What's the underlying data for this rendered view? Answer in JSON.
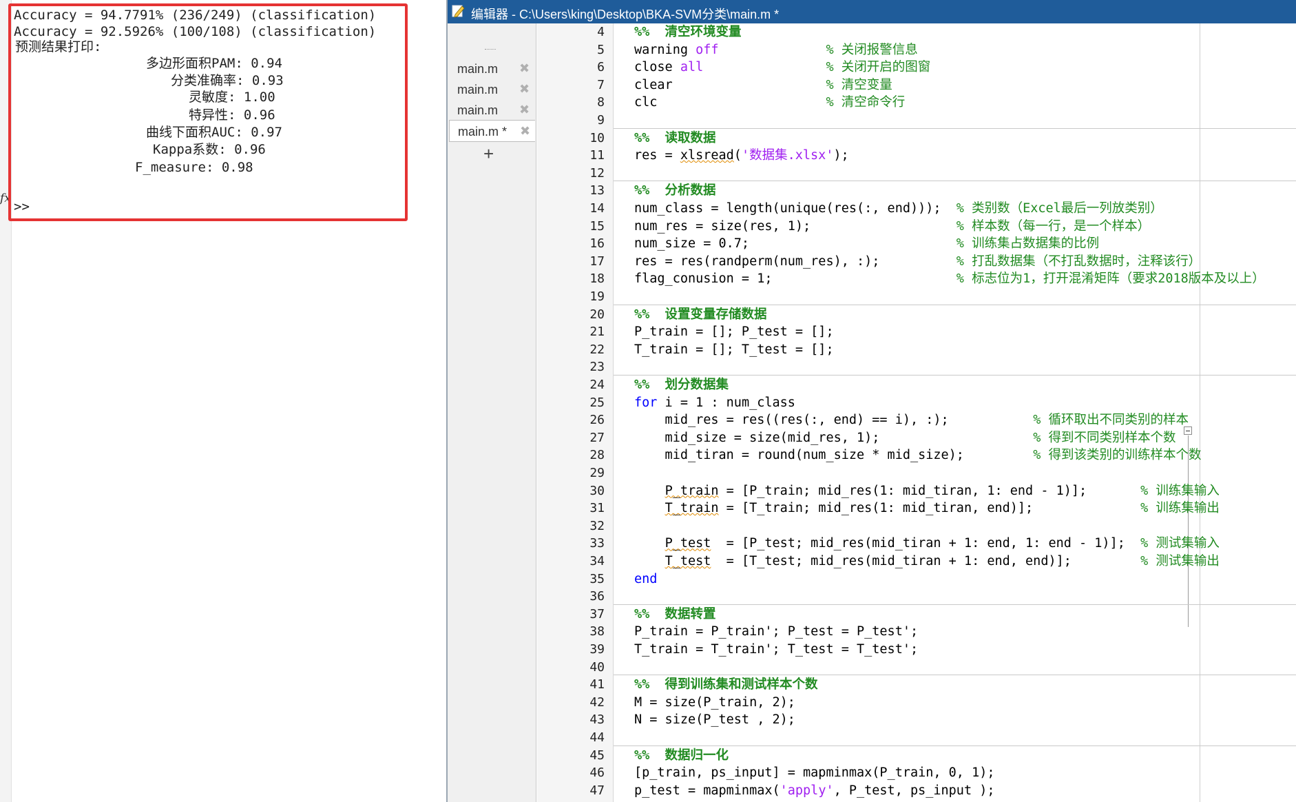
{
  "command_window": {
    "lines": [
      "Accuracy = 94.7791% (236/249) (classification)",
      "Accuracy = 92.5926% (100/108) (classification)",
      "预测结果打印:",
      "多边形面积PAM: 0.94",
      "分类准确率: 0.93",
      "灵敏度: 1.00",
      "特异性: 0.96",
      "曲线下面积AUC: 0.97",
      "Kappa系数: 0.96",
      "F_measure: 0.98"
    ],
    "prompt": ">>",
    "fx_glyph": "fx",
    "highlight_color": "#e53333"
  },
  "editor": {
    "title": "编辑器 - C:\\Users\\king\\Desktop\\BKA-SVM分类\\main.m *",
    "tabs": [
      {
        "label": "main.m",
        "close": "✖"
      },
      {
        "label": "main.m",
        "close": "✖"
      },
      {
        "label": "main.m",
        "close": "✖"
      },
      {
        "label": "main.m *",
        "close": "✖",
        "active": true
      }
    ],
    "add_tab": "+",
    "line_numbers": [
      4,
      5,
      6,
      7,
      8,
      9,
      10,
      11,
      12,
      13,
      14,
      15,
      16,
      17,
      18,
      19,
      20,
      21,
      22,
      23,
      24,
      25,
      26,
      27,
      28,
      29,
      30,
      31,
      32,
      33,
      34,
      35,
      36,
      37,
      38,
      39,
      40,
      41,
      42,
      43,
      44,
      45,
      46,
      47
    ],
    "lines": [
      [
        [
          "cm",
          "%%  清空环境变量"
        ]
      ],
      [
        [
          "n",
          "warning "
        ],
        [
          "str",
          "off"
        ],
        [
          "n",
          "              "
        ],
        [
          "cmt",
          "% 关闭报警信息"
        ]
      ],
      [
        [
          "n",
          "close "
        ],
        [
          "str",
          "all"
        ],
        [
          "n",
          "                "
        ],
        [
          "cmt",
          "% 关闭开启的图窗"
        ]
      ],
      [
        [
          "n",
          "clear                    "
        ],
        [
          "cmt",
          "% 清空变量"
        ]
      ],
      [
        [
          "n",
          "clc                      "
        ],
        [
          "cmt",
          "% 清空命令行"
        ]
      ],
      [],
      [
        [
          "cm",
          "%%  读取数据"
        ]
      ],
      [
        [
          "n",
          "res = "
        ],
        [
          "ul",
          "xlsread"
        ],
        [
          "n",
          "("
        ],
        [
          "str",
          "'数据集.xlsx'"
        ],
        [
          "n",
          ");"
        ]
      ],
      [],
      [
        [
          "cm",
          "%%  分析数据"
        ]
      ],
      [
        [
          "n",
          "num_class = length(unique(res(:, end)));  "
        ],
        [
          "cmt",
          "% 类别数（Excel最后一列放类别）"
        ]
      ],
      [
        [
          "n",
          "num_res = size(res, 1);                   "
        ],
        [
          "cmt",
          "% 样本数（每一行，是一个样本）"
        ]
      ],
      [
        [
          "n",
          "num_size = 0.7;                           "
        ],
        [
          "cmt",
          "% 训练集占数据集的比例"
        ]
      ],
      [
        [
          "n",
          "res = res(randperm(num_res), :);          "
        ],
        [
          "cmt",
          "% 打乱数据集（不打乱数据时，注释该行）"
        ]
      ],
      [
        [
          "n",
          "flag_conusion = 1;                        "
        ],
        [
          "cmt",
          "% 标志位为1，打开混淆矩阵（要求2018版本及以上）"
        ]
      ],
      [],
      [
        [
          "cm",
          "%%  设置变量存储数据"
        ]
      ],
      [
        [
          "n",
          "P_train = []; P_test = [];"
        ]
      ],
      [
        [
          "n",
          "T_train = []; T_test = [];"
        ]
      ],
      [],
      [
        [
          "cm",
          "%%  划分数据集"
        ]
      ],
      [
        [
          "kw",
          "for"
        ],
        [
          "n",
          " i = 1 : num_class"
        ]
      ],
      [
        [
          "n",
          "    mid_res = res((res(:, end) == i), :);           "
        ],
        [
          "cmt",
          "% 循环取出不同类别的样本"
        ]
      ],
      [
        [
          "n",
          "    mid_size = size(mid_res, 1);                    "
        ],
        [
          "cmt",
          "% 得到不同类别样本个数"
        ]
      ],
      [
        [
          "n",
          "    mid_tiran = round(num_size * mid_size);         "
        ],
        [
          "cmt",
          "% 得到该类别的训练样本个数"
        ]
      ],
      [],
      [
        [
          "n",
          "    "
        ],
        [
          "ul",
          "P_train"
        ],
        [
          "n",
          " = [P_train; mid_res(1: mid_tiran, 1: end - 1)];       "
        ],
        [
          "cmt",
          "% 训练集输入"
        ]
      ],
      [
        [
          "n",
          "    "
        ],
        [
          "ul",
          "T_train"
        ],
        [
          "n",
          " = [T_train; mid_res(1: mid_tiran, end)];              "
        ],
        [
          "cmt",
          "% 训练集输出"
        ]
      ],
      [],
      [
        [
          "n",
          "    "
        ],
        [
          "ul",
          "P_test"
        ],
        [
          "n",
          "  = [P_test; mid_res(mid_tiran + 1: end, 1: end - 1)];  "
        ],
        [
          "cmt",
          "% 测试集输入"
        ]
      ],
      [
        [
          "n",
          "    "
        ],
        [
          "ul",
          "T_test"
        ],
        [
          "n",
          "  = [T_test; mid_res(mid_tiran + 1: end, end)];         "
        ],
        [
          "cmt",
          "% 测试集输出"
        ]
      ],
      [
        [
          "kw",
          "end"
        ]
      ],
      [],
      [
        [
          "cm",
          "%%  数据转置"
        ]
      ],
      [
        [
          "n",
          "P_train = P_train'; P_test = P_test';"
        ]
      ],
      [
        [
          "n",
          "T_train = T_train'; T_test = T_test';"
        ]
      ],
      [],
      [
        [
          "cm",
          "%%  得到训练集和测试样本个数"
        ]
      ],
      [
        [
          "n",
          "M = size(P_train, 2);"
        ]
      ],
      [
        [
          "n",
          "N = size(P_test , 2);"
        ]
      ],
      [],
      [
        [
          "cm",
          "%%  数据归一化"
        ]
      ],
      [
        [
          "n",
          "[p_train, ps_input] = mapminmax(P_train, 0, 1);"
        ]
      ],
      [
        [
          "n",
          "p_test = mapminmax("
        ],
        [
          "str",
          "'apply'"
        ],
        [
          "n",
          ", P_test, ps_input );"
        ]
      ]
    ],
    "section_starts": [
      10,
      13,
      20,
      24,
      37,
      41,
      45
    ],
    "colors": {
      "titlebar": "#1f5c9a",
      "comment": "#228B22",
      "keyword": "#0000ff",
      "string": "#a020f0"
    }
  }
}
